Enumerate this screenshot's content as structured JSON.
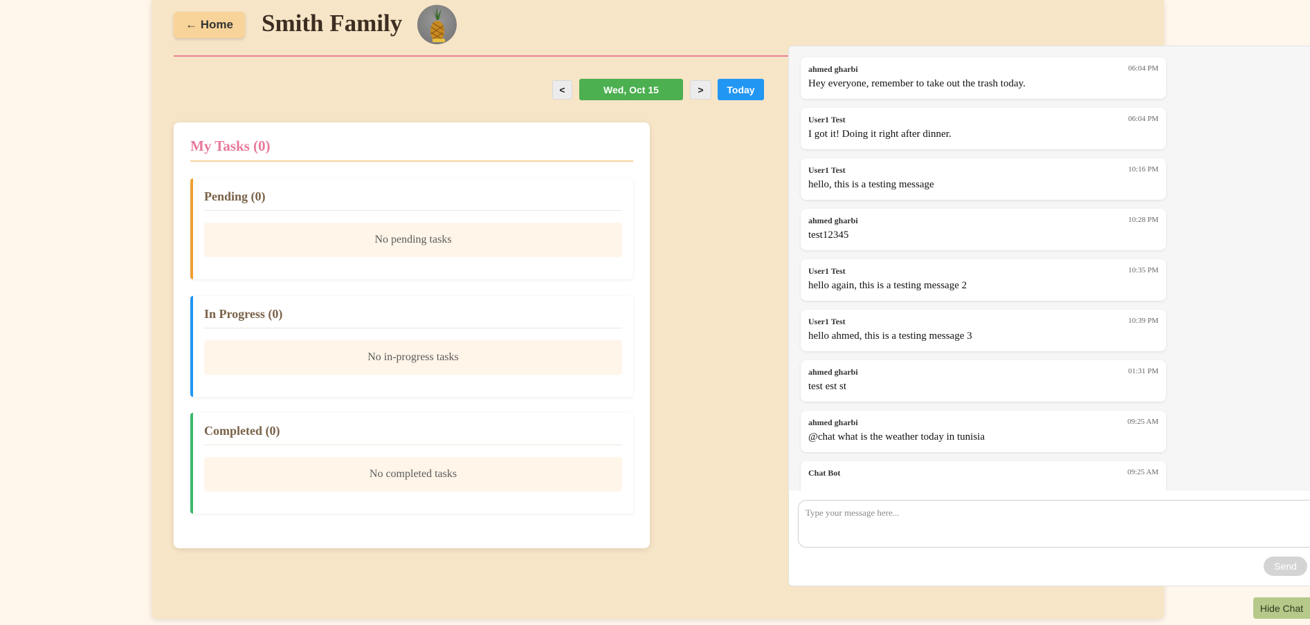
{
  "header": {
    "home_label": "← Home",
    "family_name": "Smith Family"
  },
  "date_nav": {
    "prev_label": "<",
    "current_date": "Wed, Oct 15",
    "next_label": ">",
    "today_label": "Today"
  },
  "tasks": {
    "title": "My Tasks (0)",
    "sections": [
      {
        "title": "Pending (0)",
        "empty_text": "No pending tasks",
        "accent": "#f0a030"
      },
      {
        "title": "In Progress (0)",
        "empty_text": "No in-progress tasks",
        "accent": "#2196f3"
      },
      {
        "title": "Completed (0)",
        "empty_text": "No completed tasks",
        "accent": "#3cb96a"
      }
    ]
  },
  "chat": {
    "messages": [
      {
        "author": "ahmed gharbi",
        "time": "06:04 PM",
        "text": "Hey everyone, remember to take out the trash today."
      },
      {
        "author": "User1 Test",
        "time": "06:04 PM",
        "text": "I got it! Doing it right after dinner."
      },
      {
        "author": "User1 Test",
        "time": "10:16 PM",
        "text": "hello, this is a testing message"
      },
      {
        "author": "ahmed gharbi",
        "time": "10:28 PM",
        "text": "test12345"
      },
      {
        "author": "User1 Test",
        "time": "10:35 PM",
        "text": "hello again, this is a testing message 2"
      },
      {
        "author": "User1 Test",
        "time": "10:39 PM",
        "text": "hello ahmed, this is a testing message 3"
      },
      {
        "author": "ahmed gharbi",
        "time": "01:31 PM",
        "text": "test est st"
      },
      {
        "author": "ahmed gharbi",
        "time": "09:25 AM",
        "text": "@chat what is the weather today in tunisia"
      },
      {
        "author": "Chat Bot",
        "time": "09:25 AM",
        "text": ""
      }
    ],
    "input_placeholder": "Type your message here...",
    "send_label": "Send",
    "hide_label": "Hide Chat"
  },
  "colors": {
    "accent_pink": "#ec7d9a",
    "date_green": "#4caf50",
    "today_blue": "#2196f3",
    "panel_bg": "#f7e5c7"
  }
}
